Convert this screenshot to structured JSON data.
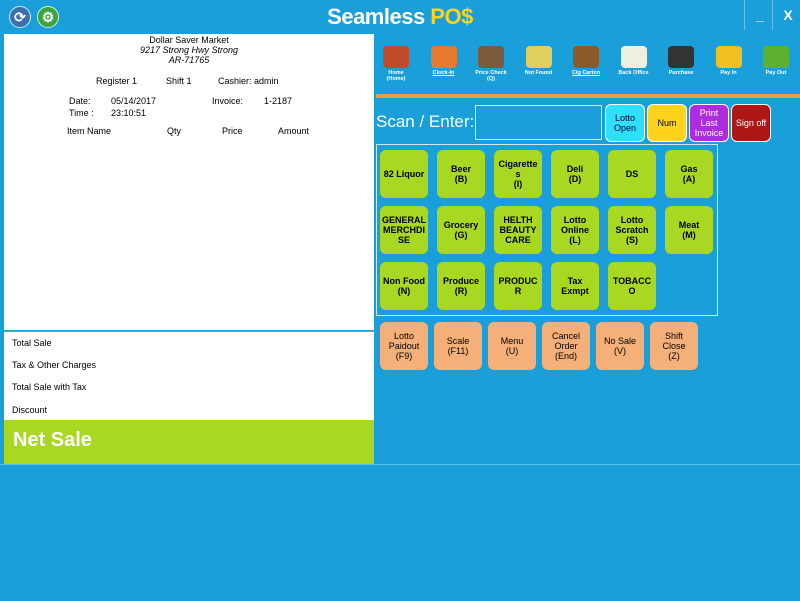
{
  "app": {
    "title_main": "Seamless ",
    "title_accent": "PO$",
    "minimize": "_",
    "close": "X"
  },
  "receipt": {
    "store_name": "Dollar Saver Market",
    "address": "9217 Strong Hwy Strong",
    "zip": "AR-71765",
    "register": "Register 1",
    "shift": "Shift 1",
    "cashier": "Cashier: admin",
    "date_label": "Date:",
    "date": "05/14/2017",
    "invoice_label": "Invoice:",
    "invoice": "1-2187",
    "time_label": "Time :",
    "time": "23:10:51",
    "columns": [
      "Item Name",
      "Qty",
      "Price",
      "Amount"
    ]
  },
  "totals": {
    "total_sale": "Total Sale",
    "tax": "Tax & Other Charges",
    "total_with_tax": "Total Sale with Tax",
    "discount": "Discount",
    "net_sale": "Net Sale"
  },
  "toolbar": [
    {
      "label": "Home\n(Home)",
      "icon": "home-icon",
      "color": "#c04a2a",
      "underline": false
    },
    {
      "label": "Clock-In",
      "icon": "person-icon",
      "color": "#e87a30",
      "underline": true
    },
    {
      "label": "Price Check\n(Q)",
      "icon": "hourglass-icon",
      "color": "#7a5a3a",
      "underline": false
    },
    {
      "label": "Not Found",
      "icon": "trash-icon",
      "color": "#e0d060",
      "underline": false
    },
    {
      "label": "Cig Carton",
      "icon": "carton-icon",
      "color": "#8a5a2a",
      "underline": true
    },
    {
      "label": "Back Office",
      "icon": "notepad-icon",
      "color": "#f0f0e0",
      "underline": false
    },
    {
      "label": "Purchase",
      "icon": "businessman-icon",
      "color": "#333333",
      "underline": false
    },
    {
      "label": "Pay In",
      "icon": "money-icon",
      "color": "#f0c020",
      "underline": false
    },
    {
      "label": "Pay Out",
      "icon": "pen-money-icon",
      "color": "#60b030",
      "underline": false
    }
  ],
  "scan": {
    "label": "Scan / Enter:",
    "value": ""
  },
  "top_buttons": {
    "lotto_open": "Lotto Open",
    "num": "Num",
    "print_last_invoice": "Print Last Invoice",
    "sign_off": "Sign off"
  },
  "departments": [
    "82 Liquor",
    "Beer\n(B)",
    "Cigarette\ns\n(I)",
    "Deli\n(D)",
    "DS",
    "Gas\n(A)",
    "GENERAL\nMERCHDI\nSE",
    "Grocery\n(G)",
    "HELTH\nBEAUTY\nCARE",
    "Lotto\nOnline\n(L)",
    "Lotto\nScratch\n(S)",
    "Meat\n(M)",
    "Non Food\n(N)",
    "Produce\n(R)",
    "PRODUC\nR",
    "Tax\nExmpt",
    "TOBACC\nO"
  ],
  "function_buttons": [
    "Lotto\nPaidout\n(F9)",
    "Scale\n(F11)",
    "Menu\n(U)",
    "Cancel\nOrder\n(End)",
    "No Sale\n(V)",
    "Shift\nClose\n(Z)"
  ]
}
